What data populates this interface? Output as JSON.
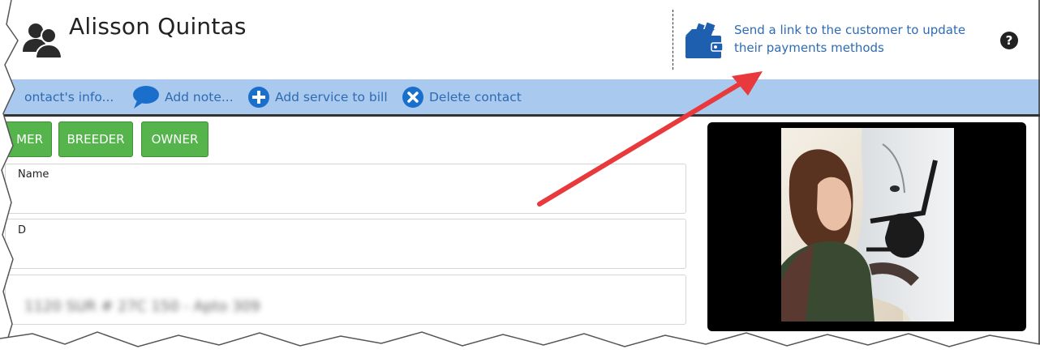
{
  "header": {
    "contact_name": "Alisson Quintas",
    "payment_link_text": "Send a link to the customer to update their payments methods"
  },
  "toolbar": {
    "edit_info_label": "ontact's info...",
    "add_note_label": "Add note...",
    "add_service_label": "Add service to bill",
    "delete_label": "Delete contact"
  },
  "tags": [
    "MER",
    "BREEDER",
    "OWNER"
  ],
  "form": {
    "field1_label": "Name",
    "field2_label": "D",
    "field3_value_blurred": "1120 SUR # 27C 150 - Apto 309"
  },
  "colors": {
    "toolbar_bg": "#a9c9ee",
    "link": "#2f6bb3",
    "tag_green": "#55b44b",
    "annotation_arrow": "#e8393c"
  }
}
